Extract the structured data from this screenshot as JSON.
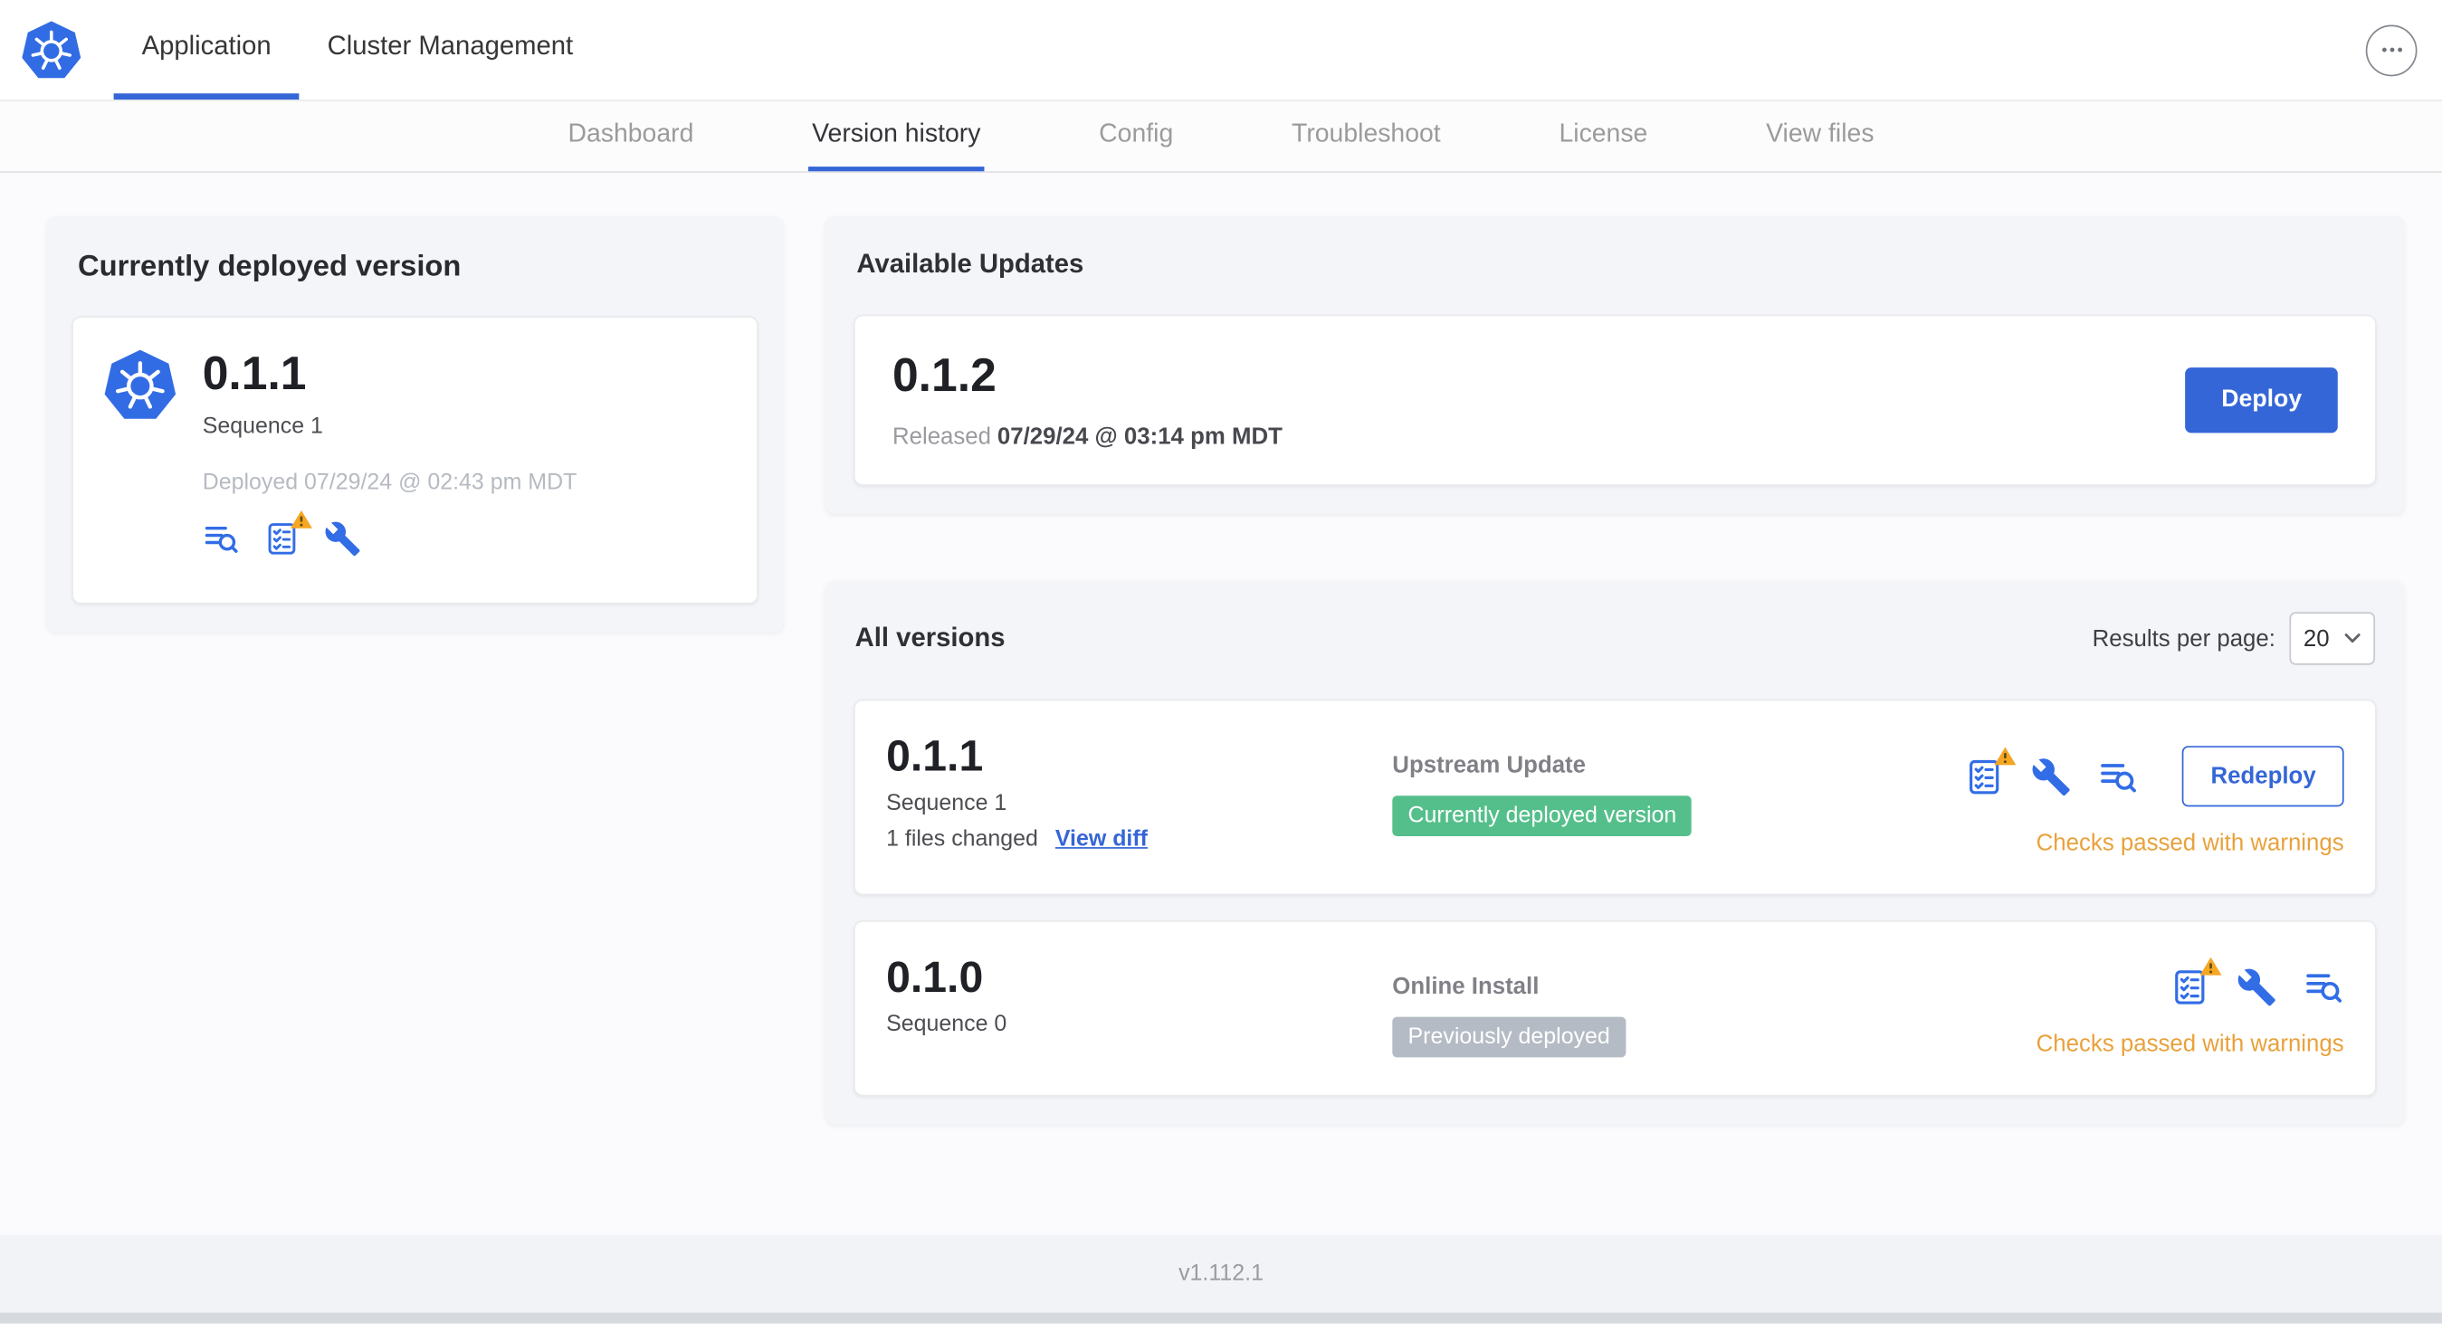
{
  "header": {
    "tabs": [
      {
        "label": "Application"
      },
      {
        "label": "Cluster Management"
      }
    ]
  },
  "subnav": {
    "items": [
      {
        "label": "Dashboard"
      },
      {
        "label": "Version history"
      },
      {
        "label": "Config"
      },
      {
        "label": "Troubleshoot"
      },
      {
        "label": "License"
      },
      {
        "label": "View files"
      }
    ],
    "active": "Version history"
  },
  "current_version": {
    "title": "Currently deployed version",
    "version": "0.1.1",
    "sequence": "Sequence 1",
    "deployed_at": "Deployed 07/29/24 @ 02:43 pm MDT"
  },
  "available_updates": {
    "title": "Available Updates",
    "version": "0.1.2",
    "released_label": "Released",
    "released_at": "07/29/24 @ 03:14 pm MDT",
    "deploy_button": "Deploy"
  },
  "all_versions": {
    "title": "All versions",
    "results_per_page_label": "Results per page:",
    "results_per_page": "20",
    "rows": [
      {
        "version": "0.1.1",
        "sequence": "Sequence 1",
        "files_changed": "1 files changed",
        "diff_link": "View diff",
        "source": "Upstream Update",
        "badge": "Currently deployed version",
        "status": "Checks passed with warnings",
        "action_button": "Redeploy"
      },
      {
        "version": "0.1.0",
        "sequence": "Sequence 0",
        "source": "Online Install",
        "badge": "Previously deployed",
        "status": "Checks passed with warnings"
      }
    ]
  },
  "footer": {
    "app_version": "v1.112.1"
  },
  "icons": {
    "logo": "kubernetes-logo",
    "menu": "ellipsis-icon",
    "logs": "deploy-logs-icon",
    "checks": "preflight-checks-icon",
    "warning": "warning-triangle-icon",
    "config": "config-wrench-icon",
    "chevron": "chevron-down-icon"
  },
  "colors": {
    "accent_blue": "#3566d7",
    "k8s_blue": "#326ce5",
    "warning_orange": "#e9a13b",
    "badge_green": "#55bf8b",
    "badge_gray": "#b4bbc4"
  }
}
